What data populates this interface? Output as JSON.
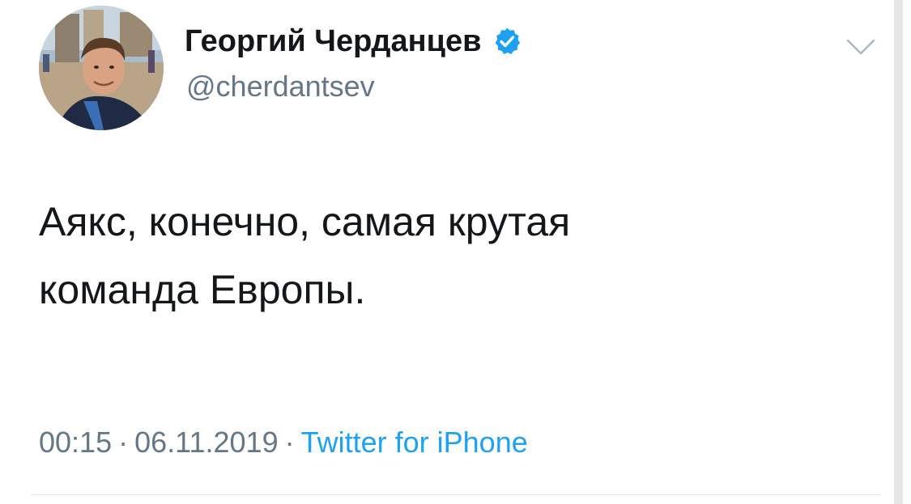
{
  "author": {
    "display_name": "Георгий Черданцев",
    "handle": "@cherdantsev",
    "verified": true,
    "avatar_icon": "profile-photo"
  },
  "tweet": {
    "lines": [
      "Аякс, конечно, самая крутая",
      "команда Европы."
    ],
    "time": "00:15",
    "separator": "·",
    "date": "06.11.2019",
    "source": "Twitter for iPhone"
  },
  "icons": {
    "verified": "verified-badge-icon",
    "menu": "chevron-down-icon"
  },
  "colors": {
    "text": "#14171a",
    "secondary": "#657786",
    "accent": "#1da1f2",
    "divider": "#e1e8ed"
  }
}
